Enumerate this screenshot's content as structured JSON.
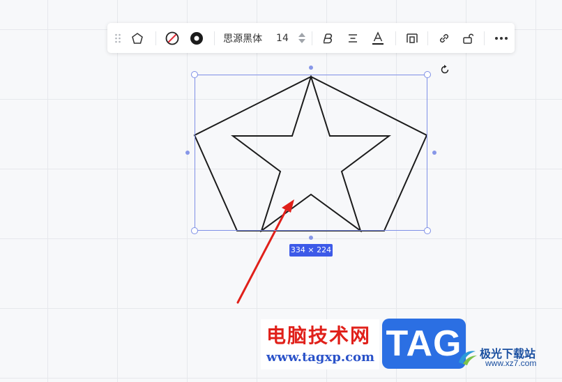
{
  "toolbar": {
    "font_name": "思源黑体",
    "font_size": "14"
  },
  "selection": {
    "size_label": "334 × 224"
  },
  "colors": {
    "selection_border": "#7e8fe6",
    "size_badge": "#3d5ae8",
    "annotation_arrow": "#e0201a"
  },
  "watermark": {
    "site_name_cn": "电脑技术网",
    "site_url": "www.tagxp.com",
    "tag_logo": "TAG",
    "right_name_cn": "极光下载站",
    "right_url": "www.xz7.com"
  }
}
